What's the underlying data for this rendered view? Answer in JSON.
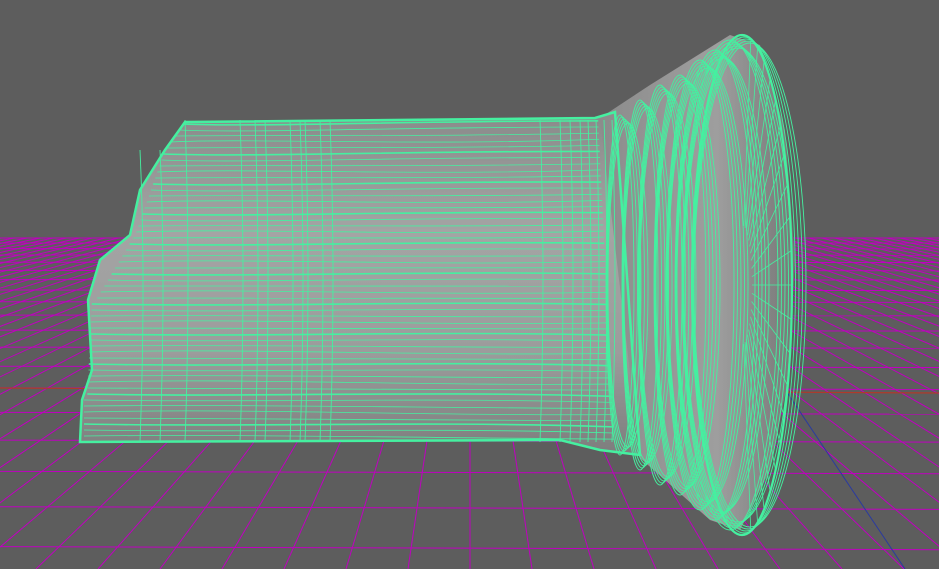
{
  "viewport": {
    "background_color": "#5d5d5d",
    "grid_color": "#c000c0",
    "axis_x_color": "#b03a2a",
    "axis_z_color": "#2a3aa0",
    "wireframe_color": "#45f0a0",
    "surface_color": "#9a9a9a"
  },
  "object": {
    "name": "column",
    "display_mode": "wireframe-on-shaded",
    "selected": true
  }
}
